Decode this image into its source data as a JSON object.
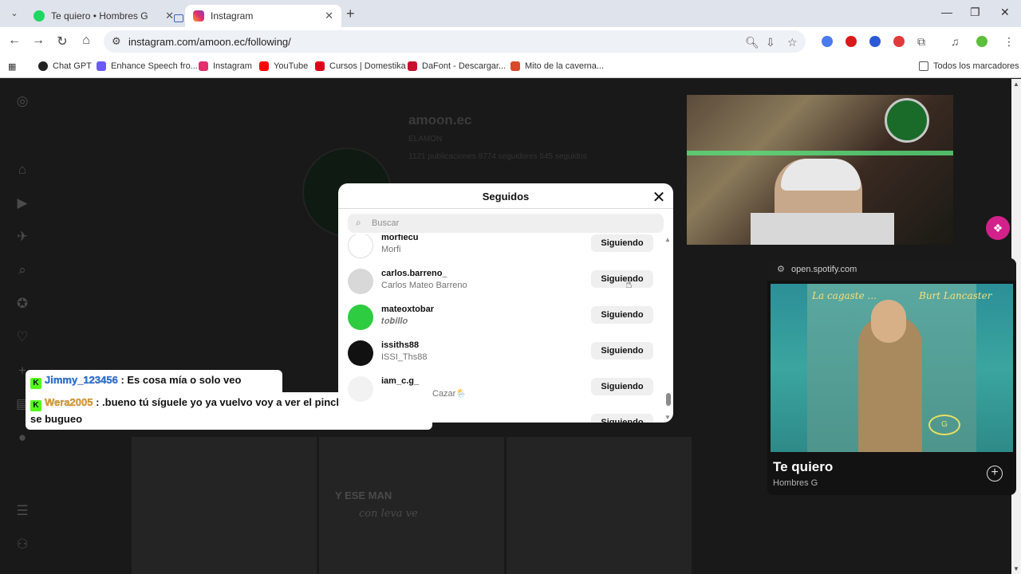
{
  "browser": {
    "tabs": [
      {
        "title": "Te quiero • Hombres G"
      },
      {
        "title": "Instagram"
      }
    ],
    "url": "instagram.com/amoon.ec/following/",
    "bookmarks": [
      {
        "label": "Chat GPT",
        "color": "#222222"
      },
      {
        "label": "Enhance Speech fro...",
        "color": "#6a5cff"
      },
      {
        "label": "Instagram",
        "color": "#e1306c"
      },
      {
        "label": "YouTube",
        "color": "#ff0000"
      },
      {
        "label": "Cursos | Domestika",
        "color": "#e0001b"
      },
      {
        "label": "DaFont - Descargar...",
        "color": "#c8102e"
      },
      {
        "label": "Mito de la caverna...",
        "color": "#d84a2a"
      }
    ],
    "all_bookmarks": "Todos los marcadores"
  },
  "profile": {
    "name": "amoon.ec",
    "subtitle": "ELAMON",
    "stats": "1121 publicaciones   8774 seguidores   545 seguidos",
    "tile_text_1": "Y ESE MAN",
    "tile_text_2": "con leva ve"
  },
  "chat": [
    {
      "user": "Jimmy_123456",
      "message": ": Es cosa mía o solo veo mujeres"
    },
    {
      "user": "Wera2005",
      "message": ": .bueno tú síguele yo ya vuelvo voy a ver el pinche vlog que subí se bugueo"
    }
  ],
  "modal": {
    "title": "Seguidos",
    "search_placeholder": "Buscar",
    "items": [
      {
        "username": "morfiecu",
        "fullname": "Morfi",
        "button": "Siguiendo"
      },
      {
        "username": "carlos.barreno_",
        "fullname": "Carlos Mateo Barreno",
        "button": "Siguiendo"
      },
      {
        "username": "mateoxtobar",
        "fullname": "𝒕𝒐𝒃𝒊𝒍𝒍𝒐",
        "button": "Siguiendo"
      },
      {
        "username": "issiths88",
        "fullname": "ISSI_Ths88",
        "button": "Siguiendo"
      },
      {
        "username": "iam_c.g_",
        "fullname": "Cazar🌦️",
        "button": "Siguiendo"
      },
      {
        "username": "",
        "fullname": "",
        "button": "Siguiendo"
      }
    ]
  },
  "spotify": {
    "host": "open.spotify.com",
    "title": "Te quiero",
    "artist": "Hombres G",
    "cover_text_left": "La cagaste ...",
    "cover_text_right": "Burt Lancaster",
    "cover_seal": "G"
  }
}
